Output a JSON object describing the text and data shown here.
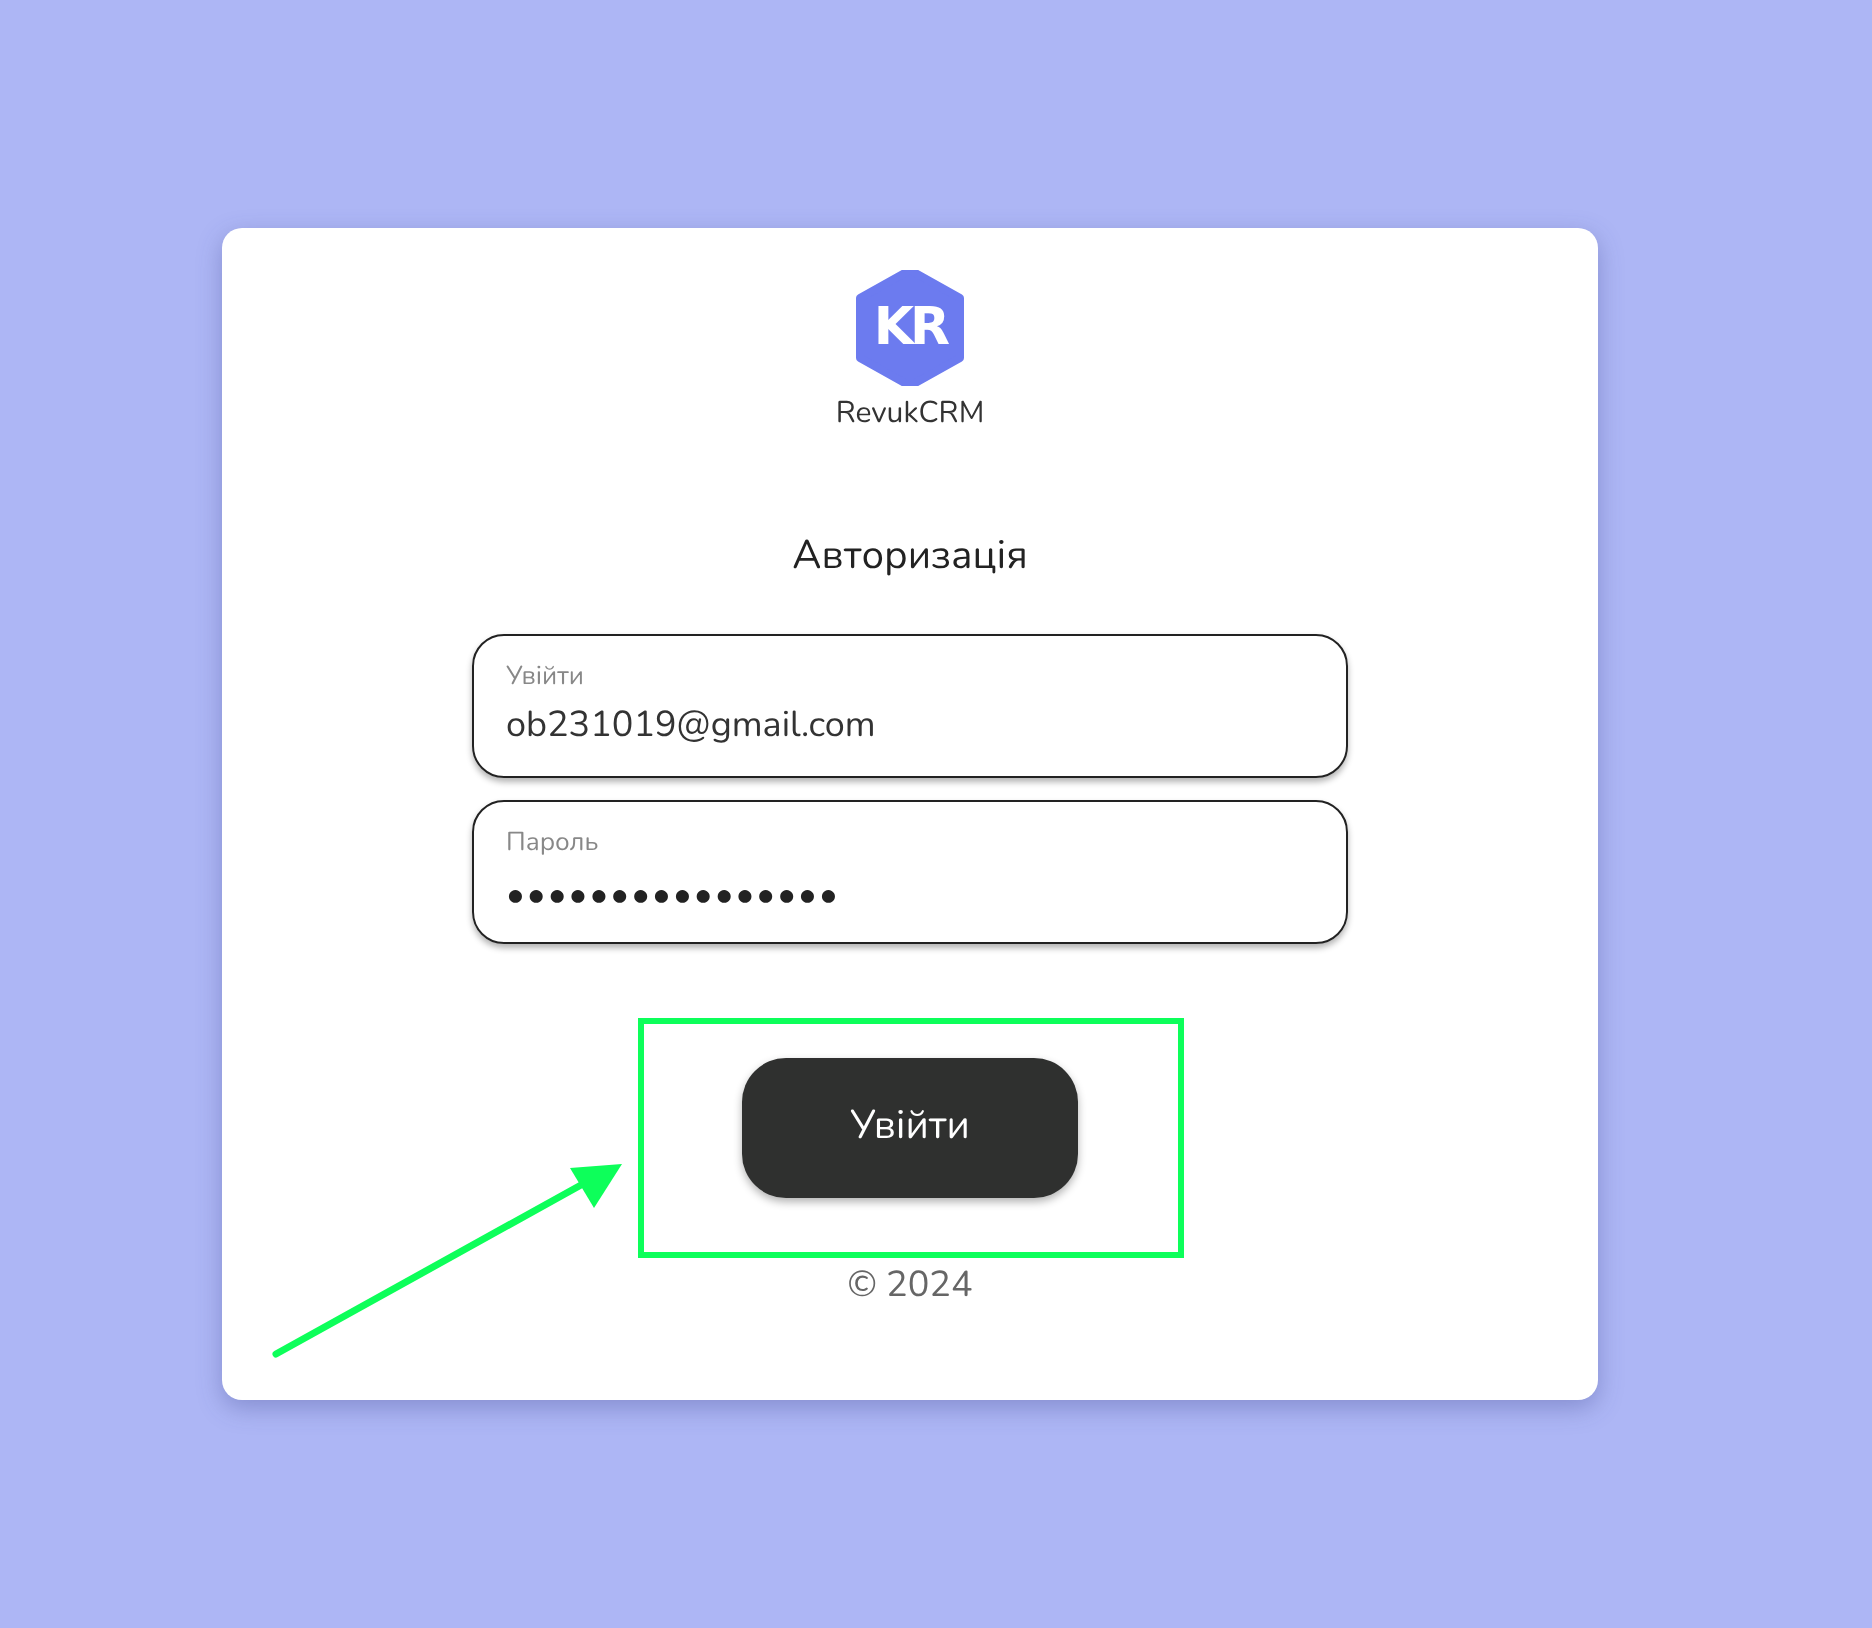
{
  "logo": {
    "mark": "KR",
    "name": "RevukCRM"
  },
  "title": "Авторизація",
  "fields": [
    {
      "label": "Увійти",
      "value": "ob231019@gmail.com",
      "kind": "text"
    },
    {
      "label": "Пароль",
      "value": "••••••••••••••••",
      "kind": "password"
    }
  ],
  "submit_button": "Увійти",
  "footer": "© 2024",
  "annotation": {
    "highlight": true,
    "arrow": true
  }
}
